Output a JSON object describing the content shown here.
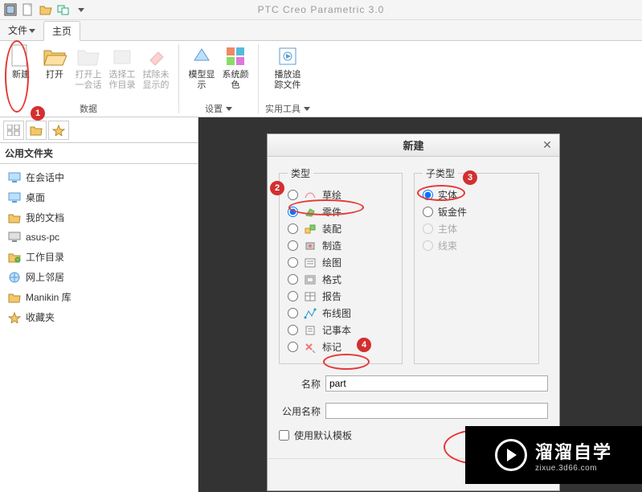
{
  "app_title": "PTC Creo Parametric 3.0",
  "menu": {
    "file": "文件",
    "home": "主页"
  },
  "ribbon": {
    "new": "新建",
    "open": "打开",
    "open_last": "打开上一会话",
    "select_wd": "选择工作目录",
    "clear_undisp": "拭除未显示的",
    "model_disp": "模型显示",
    "sys_colors": "系统颜色",
    "play_track": "播放追踪文件",
    "grp_data": "数据",
    "grp_settings": "设置",
    "grp_tools": "实用工具"
  },
  "sidebar": {
    "title": "公用文件夹",
    "items": [
      "在会话中",
      "桌面",
      "我的文档",
      "asus-pc",
      "工作目录",
      "网上邻居",
      "Manikin 库",
      "收藏夹"
    ]
  },
  "dialog": {
    "title": "新建",
    "type_legend": "类型",
    "subtype_legend": "子类型",
    "types": [
      "草绘",
      "零件",
      "装配",
      "制造",
      "绘图",
      "格式",
      "报告",
      "布线图",
      "记事本",
      "标记"
    ],
    "type_selected": 1,
    "subtypes": [
      "实体",
      "钣金件",
      "主体",
      "线束"
    ],
    "subtype_selected": 0,
    "name_label": "名称",
    "name_value": "part",
    "common_name_label": "公用名称",
    "common_name_value": "",
    "use_default_template": "使用默认模板"
  },
  "badges": {
    "b1": "1",
    "b2": "2",
    "b3": "3",
    "b4": "4"
  },
  "watermark": {
    "main": "溜溜自学",
    "sub": "zixue.3d66.com"
  }
}
